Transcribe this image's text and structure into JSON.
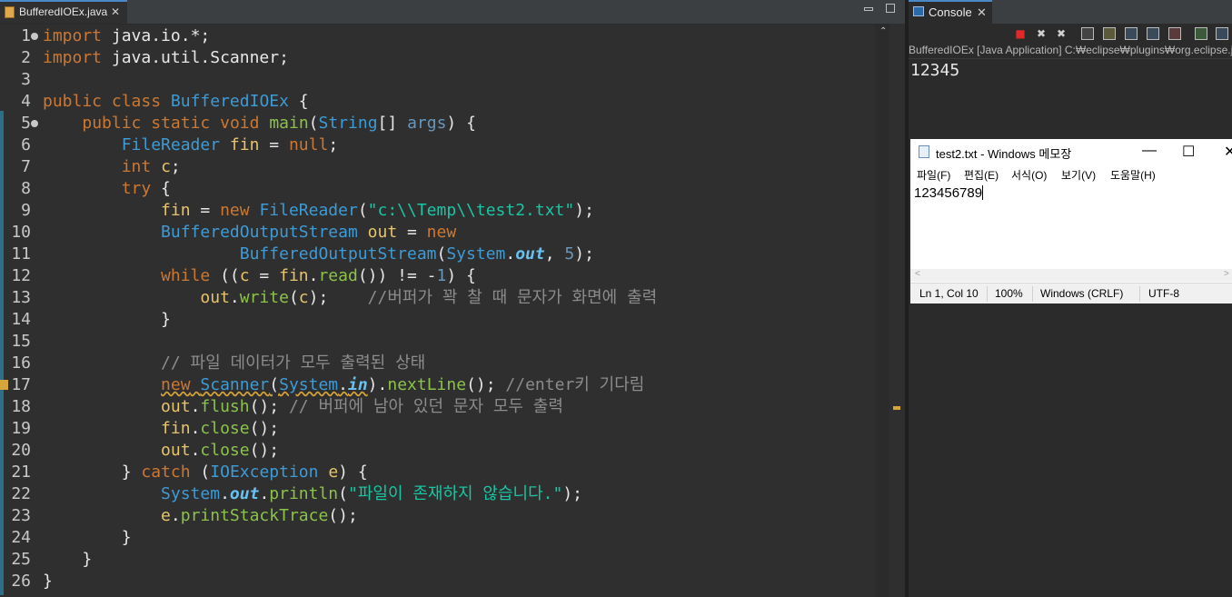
{
  "editor": {
    "tab": {
      "title": "BufferedIOEx.java",
      "close": "✕"
    },
    "line_numbers": [
      "1",
      "2",
      "3",
      "4",
      "5",
      "6",
      "7",
      "8",
      "9",
      "10",
      "11",
      "12",
      "13",
      "14",
      "15",
      "16",
      "17",
      "18",
      "19",
      "20",
      "21",
      "22",
      "23",
      "24",
      "25",
      "26"
    ],
    "code": {
      "l1": [
        "import",
        " java.io.*;"
      ],
      "l2": [
        "import",
        " java.util.Scanner;"
      ],
      "l4": [
        "public",
        " ",
        "class",
        " ",
        "BufferedIOEx",
        " {"
      ],
      "l5": [
        "    ",
        "public",
        " ",
        "static",
        " ",
        "void",
        " ",
        "main",
        "(",
        "String",
        "[] ",
        "args",
        ") {"
      ],
      "l6": [
        "        ",
        "FileReader",
        " ",
        "fin",
        " = ",
        "null",
        ";"
      ],
      "l7": [
        "        ",
        "int",
        " ",
        "c",
        ";"
      ],
      "l8": [
        "        ",
        "try",
        " {"
      ],
      "l9": [
        "            ",
        "fin",
        " = ",
        "new",
        " ",
        "FileReader",
        "(",
        "\"c:\\\\Temp\\\\test2.txt\"",
        ");"
      ],
      "l10": [
        "            ",
        "BufferedOutputStream",
        " ",
        "out",
        " = ",
        "new"
      ],
      "l11": [
        "                    ",
        "BufferedOutputStream",
        "(",
        "System",
        ".",
        "out",
        ", ",
        "5",
        ");"
      ],
      "l12": [
        "            ",
        "while",
        " ((",
        "c",
        " = ",
        "fin",
        ".",
        "read",
        "()) != -",
        "1",
        ") {"
      ],
      "l13": [
        "                ",
        "out",
        ".",
        "write",
        "(",
        "c",
        ");    ",
        "//버퍼가 꽉 찰 때 문자가 화면에 출력"
      ],
      "l14": [
        "            ",
        "}"
      ],
      "l16": [
        "            ",
        "// 파일 데이터가 모두 출력된 상태"
      ],
      "l17": [
        "            ",
        "new",
        " ",
        "Scanner",
        "(",
        "System",
        ".",
        "in",
        ").",
        "nextLine",
        "(); ",
        "//enter키 기다림"
      ],
      "l18": [
        "            ",
        "out",
        ".",
        "flush",
        "(); ",
        "// 버퍼에 남아 있던 문자 모두 출력"
      ],
      "l19": [
        "            ",
        "fin",
        ".",
        "close",
        "();"
      ],
      "l20": [
        "            ",
        "out",
        ".",
        "close",
        "();"
      ],
      "l21": [
        "        ",
        "} ",
        "catch",
        " (",
        "IOException",
        " ",
        "e",
        ") {"
      ],
      "l22": [
        "            ",
        "System",
        ".",
        "out",
        ".",
        "println",
        "(",
        "\"파일이 존재하지 않습니다.\"",
        ");"
      ],
      "l23": [
        "            ",
        "e",
        ".",
        "printStackTrace",
        "();"
      ],
      "l24": [
        "        ",
        "}"
      ],
      "l25": [
        "    ",
        "}"
      ],
      "l26": [
        "}"
      ]
    }
  },
  "console": {
    "tab": {
      "title": "Console",
      "close": "✕"
    },
    "path": "BufferedIOEx [Java Application] C:₩eclipse₩plugins₩org.eclipse.ju",
    "output": "12345",
    "toolbar": {
      "terminate": "■",
      "remove": "✖",
      "remove_all": "✖"
    }
  },
  "notepad": {
    "title": "test2.txt - Windows 메모장",
    "window_buttons": {
      "minimize": "—",
      "maximize": "☐",
      "close": "✕"
    },
    "menu": [
      "파일(F)",
      "편집(E)",
      "서식(O)",
      "보기(V)",
      "도움말(H)"
    ],
    "content": "123456789",
    "scroll": {
      "left": "<",
      "right": ">"
    },
    "status": {
      "position": "Ln 1, Col 10",
      "zoom": "100%",
      "line_ending": "Windows (CRLF)",
      "encoding": "UTF-8"
    }
  },
  "colors": {
    "keyword": "#cc7832",
    "class": "#3d9bd6",
    "identifier": "#e8c46a",
    "method": "#8bc34a",
    "string": "#17c6a3",
    "comment": "#8c8c8c",
    "accent": "#4a88c7",
    "terminate": "#e02a2a"
  }
}
